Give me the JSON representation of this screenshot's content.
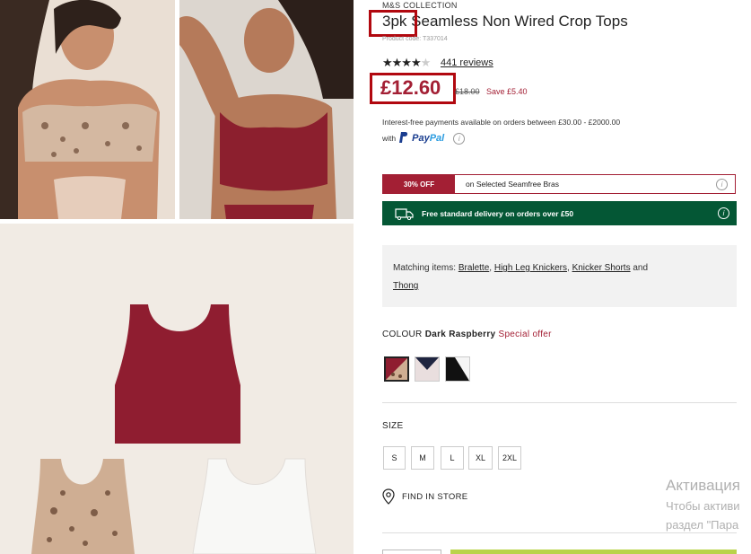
{
  "product": {
    "brand": "M&S COLLECTION",
    "title_highlight": "3pk",
    "title_rest": " Seamless Non Wired Crop Tops",
    "code": "Product code: T337014",
    "stars": "★★★★",
    "star_empty": "★",
    "rating": 4,
    "reviews": "441 reviews",
    "price": "£12.60",
    "was_price": "£18.00",
    "save": "Save £5.40"
  },
  "payment": {
    "line1": "Interest-free payments available on orders between £30.00 - £2000.00",
    "with": "with",
    "paypal_pay": "Pay",
    "paypal_pal": "Pal",
    "info_icon": "info-icon"
  },
  "offer": {
    "tag": "30% OFF",
    "text": "on Selected Seamfree Bras"
  },
  "delivery": {
    "text": "Free standard delivery on orders over £50",
    "icon": "truck-icon"
  },
  "matching": {
    "label": "Matching items:",
    "items": [
      "Bralette",
      "High Leg Knickers",
      "Knicker Shorts"
    ],
    "and": "and",
    "last_item": "Thong"
  },
  "colour": {
    "label": "COLOUR",
    "value": "Dark Raspberry",
    "special": "Special offer",
    "swatches": [
      "dark-raspberry",
      "navy-pink",
      "black-white"
    ]
  },
  "size": {
    "label": "SIZE",
    "options": [
      "S",
      "M",
      "L",
      "XL",
      "2XL"
    ]
  },
  "store": {
    "label": "FIND IN STORE",
    "icon": "location-pin-icon"
  },
  "watermark": {
    "line1": "Активация",
    "line2": "Чтобы активи",
    "line3": "раздел \"Пара"
  },
  "colors": {
    "brand_red": "#a31f34",
    "delivery_green": "#045735",
    "highlight_box": "#b1080f"
  }
}
